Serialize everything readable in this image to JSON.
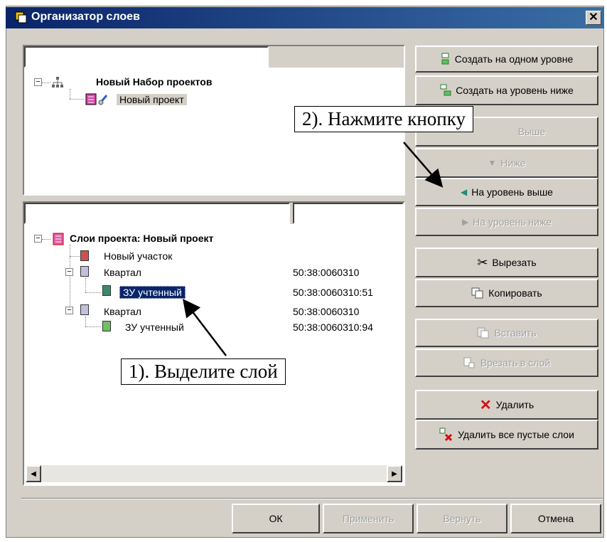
{
  "window": {
    "title": "Организатор слоев",
    "close_label": "✕"
  },
  "top_tree": {
    "root_label": "Новый Набор проектов",
    "project_label": "Новый проект"
  },
  "bottom_tree": {
    "root_label": "Слои проекта: Новый проект",
    "items": [
      {
        "label": "Новый участок",
        "value": ""
      },
      {
        "label": "Квартал",
        "value": "50:38:0060310"
      },
      {
        "label": "ЗУ учтенный",
        "value": "50:38:0060310:51"
      },
      {
        "label": "Квартал",
        "value": "50:38:0060310"
      },
      {
        "label": "ЗУ учтенный",
        "value": "50:38:0060310:94"
      }
    ]
  },
  "buttons": {
    "create_same": "Создать на одном уровне",
    "create_below": "Создать на уровень ниже",
    "up": "Выше",
    "down": "Ниже",
    "level_up": "На уровень выше",
    "level_down": "На уровень ниже",
    "cut": "Вырезать",
    "copy": "Копировать",
    "paste": "Вставить",
    "cut_into": "Врезать в слой",
    "delete": "Удалить",
    "delete_empty": "Удалить все пустые слои",
    "ok": "ОК",
    "apply": "Применить",
    "revert": "Вернуть",
    "cancel": "Отмена"
  },
  "annotations": {
    "step1": "1). Выделите слой",
    "step2": "2). Нажмите кнопку"
  },
  "scrollbar": {
    "left_arrow": "◀",
    "right_arrow": "▶"
  }
}
